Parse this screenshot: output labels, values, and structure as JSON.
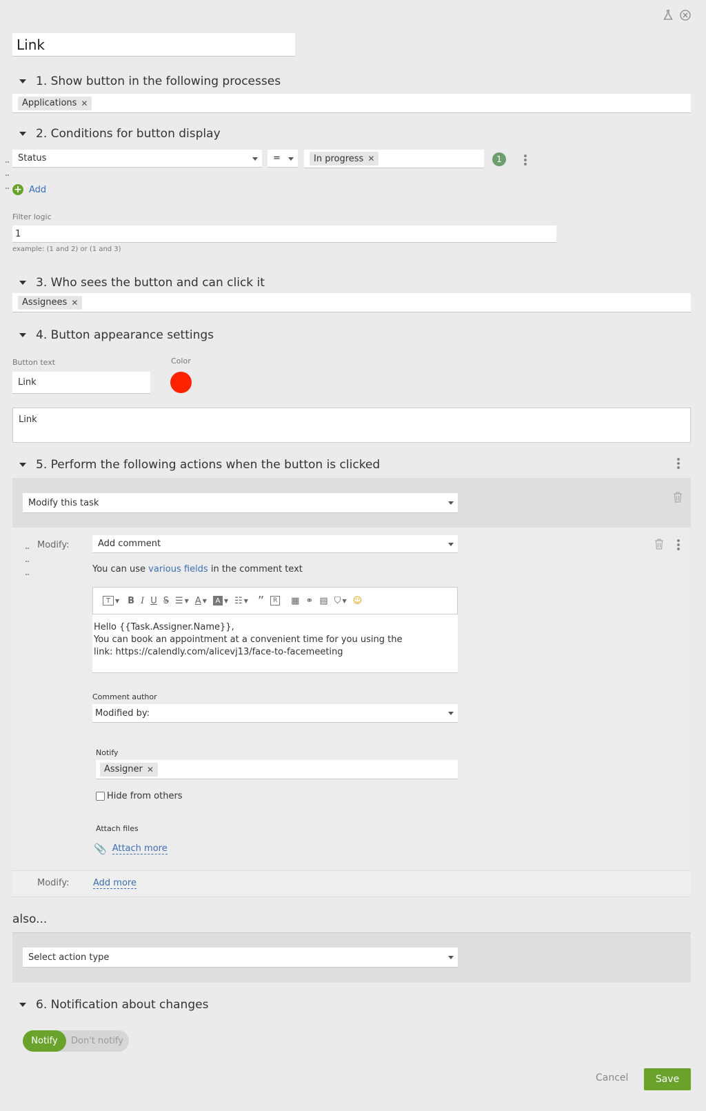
{
  "window": {
    "name_value": "Link"
  },
  "sections": {
    "s1": "1. Show button in the following processes",
    "s2": "2. Conditions for button display",
    "s3": "3. Who sees the button and can click it",
    "s4": "4. Button appearance settings",
    "s5": "5. Perform the following actions when the button is clicked",
    "s6": "6. Notification about changes"
  },
  "processes": {
    "tag": "Applications"
  },
  "conditions": {
    "field": "Status",
    "operator": "=",
    "value_tag": "In progress",
    "badge": "1",
    "add_label": "Add",
    "filter_logic_label": "Filter logic",
    "filter_logic_value": "1",
    "filter_logic_example": "example: (1 and 2) or (1 and 3)"
  },
  "who": {
    "tag": "Assignees"
  },
  "appearance": {
    "button_text_label": "Button text",
    "button_text_value": "Link",
    "color_label": "Color",
    "color_value": "#ff2200",
    "preview_text": "Link"
  },
  "actions": {
    "action_type": "Modify this task",
    "modify_label": "Modify:",
    "modify_select": "Add comment",
    "hint_prefix": "You can use ",
    "hint_link": "various fields",
    "hint_suffix": " in the comment text",
    "editor_lines": [
      "Hello {{Task.Assigner.Name}},",
      "You can book an appointment at a convenient time for you using the",
      "link: https://calendly.com/alicevj13/face-to-facemeeting"
    ],
    "comment_author_label": "Comment author",
    "comment_author_value": "Modified by:",
    "notify_label": "Notify",
    "notify_tag": "Assigner",
    "hide_label": "Hide from others",
    "attach_label": "Attach files",
    "attach_more": "Attach more",
    "modify_label2": "Modify:",
    "add_more": "Add more",
    "also_label": "also...",
    "select_action_placeholder": "Select action type"
  },
  "notification": {
    "notify_on": "Notify",
    "notify_off": "Don't notify"
  },
  "footer": {
    "cancel": "Cancel",
    "save": "Save"
  },
  "colors": {
    "accent_green": "#6aa32c",
    "link_blue": "#3b6fb6",
    "badge_green": "#6d9e6d"
  }
}
